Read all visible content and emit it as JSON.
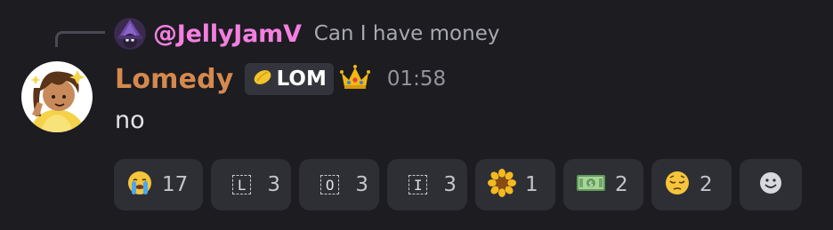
{
  "reply": {
    "username": "@JellyJamV",
    "text": "Can I have money"
  },
  "message": {
    "username": "Lomedy",
    "tag_label": "LOM",
    "timestamp": "01:58",
    "content": "no"
  },
  "reactions": [
    {
      "emoji": "loudly-crying-face",
      "count": "17"
    },
    {
      "emoji": "L",
      "count": "3"
    },
    {
      "emoji": "O",
      "count": "3"
    },
    {
      "emoji": "I",
      "count": "3"
    },
    {
      "emoji": "sunflower",
      "count": "1"
    },
    {
      "emoji": "dollar-banknote",
      "count": "2"
    },
    {
      "emoji": "pensive-face",
      "count": "2"
    }
  ],
  "colors": {
    "background": "#1c1c21",
    "reply_name": "#f47fe0",
    "username": "#d4894e",
    "reaction_bg": "#2e2f35"
  }
}
